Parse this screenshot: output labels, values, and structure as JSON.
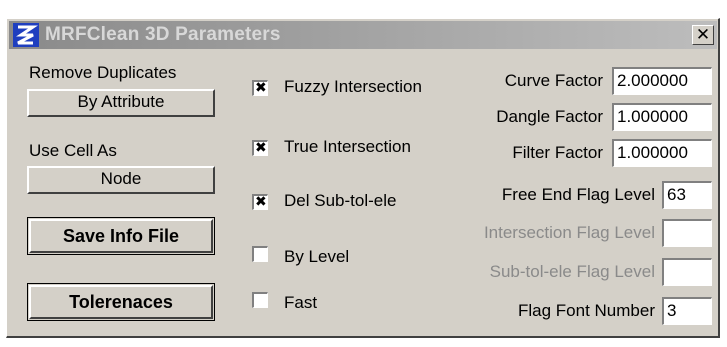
{
  "window": {
    "title": "MRFClean 3D Parameters",
    "close_label": "✕"
  },
  "left": {
    "remove_duplicates_label": "Remove Duplicates",
    "remove_duplicates_value": "By Attribute",
    "use_cell_label": "Use Cell As",
    "use_cell_value": "Node",
    "save_info_button": "Save Info File",
    "tolerances_button": "Tolerenaces"
  },
  "checkboxes": [
    {
      "label": "Fuzzy Intersection",
      "checked": true
    },
    {
      "label": "True Intersection",
      "checked": true
    },
    {
      "label": "Del Sub-tol-ele",
      "checked": true
    },
    {
      "label": "By Level",
      "checked": false
    },
    {
      "label": "Fast",
      "checked": false
    }
  ],
  "fields": {
    "curve_factor": {
      "label": "Curve Factor",
      "value": "2.000000"
    },
    "dangle_factor": {
      "label": "Dangle Factor",
      "value": "1.000000"
    },
    "filter_factor": {
      "label": "Filter Factor",
      "value": "1.000000"
    },
    "free_end_flag_level": {
      "label": "Free End Flag Level",
      "value": "63"
    },
    "intersection_flag_level": {
      "label": "Intersection Flag Level",
      "value": ""
    },
    "sub_tol_ele_flag_level": {
      "label": "Sub-tol-ele Flag Level",
      "value": ""
    },
    "flag_font_number": {
      "label": "Flag Font Number",
      "value": "3"
    }
  },
  "colors": {
    "face": "#d4d0c8",
    "title_gradient_start": "#8a8a8a",
    "disabled_text": "#8a8a8a",
    "icon_blue": "#1f3fbf"
  }
}
